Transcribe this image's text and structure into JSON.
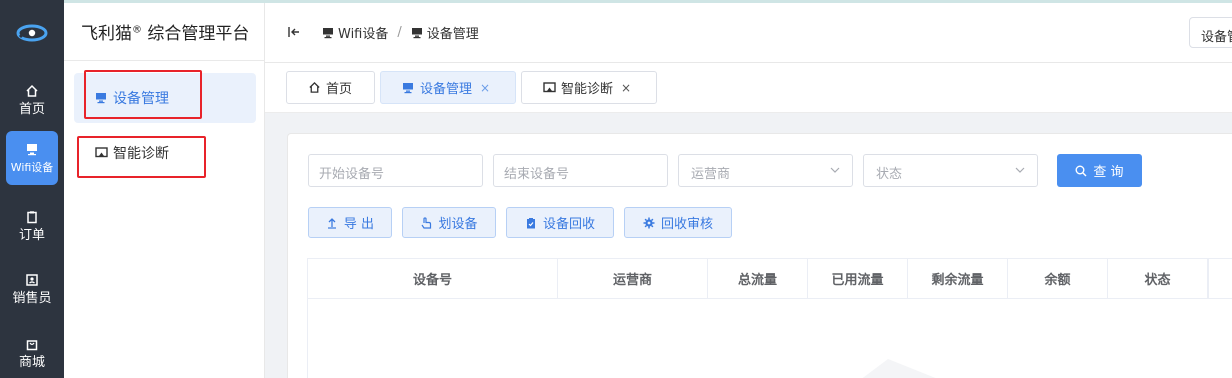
{
  "app": {
    "title": "飞利猫",
    "title_mark": "®",
    "title_suffix": "综合管理平台"
  },
  "rail": {
    "items": [
      {
        "label": "首页",
        "icon": "home-icon",
        "active": false
      },
      {
        "label": "Wifi设备",
        "icon": "monitor-icon",
        "active": true
      },
      {
        "label": "订单",
        "icon": "clipboard-icon",
        "active": false
      },
      {
        "label": "销售员",
        "icon": "contact-card-icon",
        "active": false
      },
      {
        "label": "商城",
        "icon": "shopping-bag-icon",
        "active": false
      }
    ]
  },
  "submenu": {
    "items": [
      {
        "label": "设备管理",
        "icon": "monitor-icon",
        "active": true
      },
      {
        "label": "智能诊断",
        "icon": "diagnosis-icon",
        "active": false
      }
    ]
  },
  "header": {
    "breadcrumb": [
      {
        "label": "Wifi设备",
        "icon": "monitor-icon"
      },
      {
        "label": "设备管理",
        "icon": "monitor-icon"
      }
    ],
    "separator": "/",
    "right_box": "设备管"
  },
  "tabs": [
    {
      "label": "首页",
      "icon": "home-icon",
      "closable": false,
      "active": false
    },
    {
      "label": "设备管理",
      "icon": "monitor-icon",
      "closable": true,
      "active": true
    },
    {
      "label": "智能诊断",
      "icon": "diagnosis-icon",
      "closable": true,
      "active": false
    }
  ],
  "tab_close_glyph": "×",
  "filters": {
    "start_device_placeholder": "开始设备号",
    "end_device_placeholder": "结束设备号",
    "operator_placeholder": "运营商",
    "status_placeholder": "状态",
    "query_label": "查 询"
  },
  "actions": {
    "export": "导 出",
    "assign": "划设备",
    "recycle": "设备回收",
    "recycle_review": "回收审核"
  },
  "table": {
    "columns": [
      "设备号",
      "运营商",
      "总流量",
      "已用流量",
      "剩余流量",
      "余额",
      "状态"
    ]
  },
  "colors": {
    "accent": "#4a8ff0",
    "rail_bg": "#2d343f",
    "highlight_box": "#e8232a"
  }
}
